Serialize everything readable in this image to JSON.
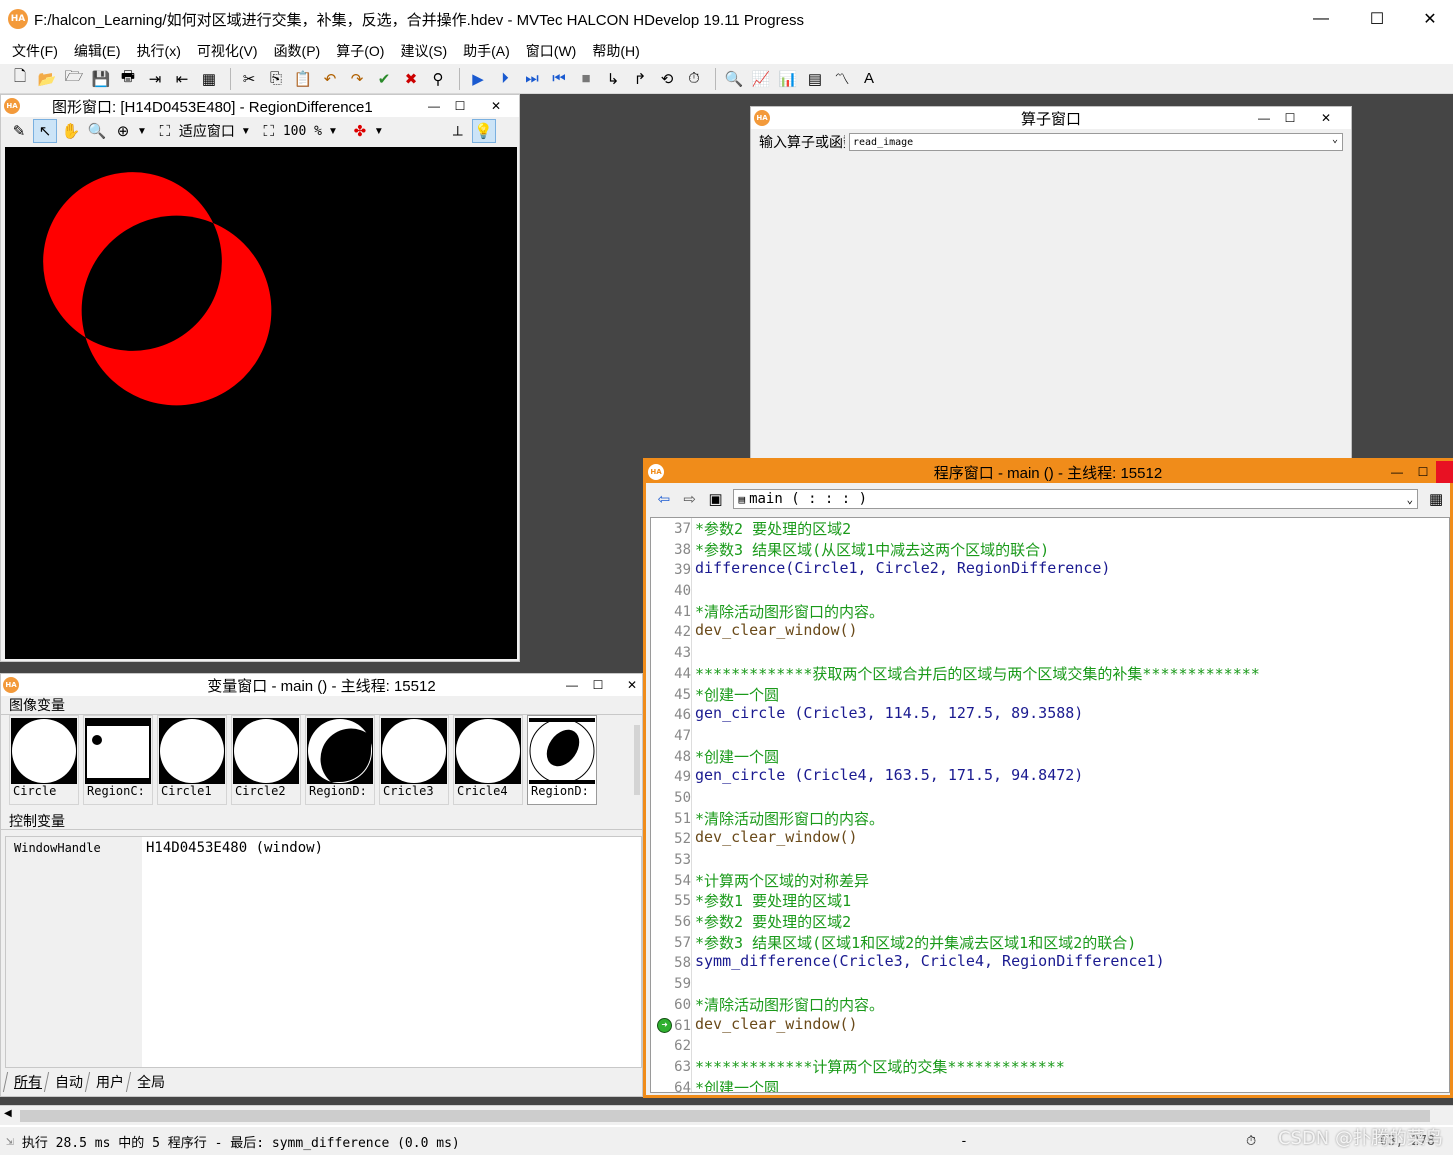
{
  "app": {
    "title": "F:/halcon_Learning/如何对区域进行交集，补集，反选，合并操作.hdev - MVTec HALCON HDevelop 19.11 Progress",
    "icon_text": "HA",
    "minimize": "—",
    "maximize": "☐",
    "close": "✕"
  },
  "menu": [
    "文件(F)",
    "编辑(E)",
    "执行(x)",
    "可视化(V)",
    "函数(P)",
    "算子(O)",
    "建议(S)",
    "助手(A)",
    "窗口(W)",
    "帮助(H)"
  ],
  "graphics_window": {
    "title": "图形窗口: [H14D0453E480] - RegionDifference1",
    "fit_label": "适应窗口",
    "zoom_label": "100 %",
    "region_color": "#ff0000"
  },
  "operator_window": {
    "title": "算子窗口",
    "input_label": "输入算子或函数",
    "input_value": "read_image"
  },
  "variable_window": {
    "title": "变量窗口 - main () - 主线程: 15512",
    "image_vars_label": "图像变量",
    "control_vars_label": "控制变量",
    "icons": [
      {
        "name": "Circle",
        "shape": "circle"
      },
      {
        "name": "RegionC:",
        "shape": "regionc"
      },
      {
        "name": "Circle1",
        "shape": "circle"
      },
      {
        "name": "Circle2",
        "shape": "circle"
      },
      {
        "name": "RegionD:",
        "shape": "regiond"
      },
      {
        "name": "Cricle3",
        "shape": "circle"
      },
      {
        "name": "Cricle4",
        "shape": "circle"
      },
      {
        "name": "RegionD:",
        "shape": "regiond2"
      }
    ],
    "control_name": "WindowHandle",
    "control_value": "H14D0453E480 (window)",
    "tabs": [
      "所有",
      "自动",
      "用户",
      "全局"
    ]
  },
  "program_window": {
    "title": "程序窗口 - main () - 主线程: 15512",
    "procedure": "main ( : : : )",
    "lines": [
      {
        "n": "37",
        "t": "*参数2 要处理的区域2",
        "k": "comment"
      },
      {
        "n": "38",
        "t": "*参数3 结果区域(从区域1中减去这两个区域的联合)",
        "k": "comment"
      },
      {
        "n": "39",
        "t": "difference(Circle1, Circle2, RegionDifference)",
        "k": "op"
      },
      {
        "n": "40",
        "t": "",
        "k": "blank"
      },
      {
        "n": "41",
        "t": "*清除活动图形窗口的内容。",
        "k": "comment"
      },
      {
        "n": "42",
        "t": "dev_clear_window()",
        "k": "ctrl"
      },
      {
        "n": "43",
        "t": "",
        "k": "blank"
      },
      {
        "n": "44",
        "t": "*************获取两个区域合并后的区域与两个区域交集的补集*************",
        "k": "comment"
      },
      {
        "n": "45",
        "t": "*创建一个圆",
        "k": "comment"
      },
      {
        "n": "46",
        "t": "gen_circle (Cricle3, 114.5, 127.5, 89.3588)",
        "k": "op"
      },
      {
        "n": "47",
        "t": "",
        "k": "blank"
      },
      {
        "n": "48",
        "t": "*创建一个圆",
        "k": "comment"
      },
      {
        "n": "49",
        "t": "gen_circle (Cricle4, 163.5, 171.5, 94.8472)",
        "k": "op"
      },
      {
        "n": "50",
        "t": "",
        "k": "blank"
      },
      {
        "n": "51",
        "t": "*清除活动图形窗口的内容。",
        "k": "comment"
      },
      {
        "n": "52",
        "t": "dev_clear_window()",
        "k": "ctrl"
      },
      {
        "n": "53",
        "t": "",
        "k": "blank"
      },
      {
        "n": "54",
        "t": "*计算两个区域的对称差异",
        "k": "comment"
      },
      {
        "n": "55",
        "t": "*参数1 要处理的区域1",
        "k": "comment"
      },
      {
        "n": "56",
        "t": "*参数2 要处理的区域2",
        "k": "comment"
      },
      {
        "n": "57",
        "t": "*参数3 结果区域(区域1和区域2的并集减去区域1和区域2的联合)",
        "k": "comment"
      },
      {
        "n": "58",
        "t": "symm_difference(Cricle3, Cricle4, RegionDifference1)",
        "k": "op"
      },
      {
        "n": "59",
        "t": "",
        "k": "blank"
      },
      {
        "n": "60",
        "t": "*清除活动图形窗口的内容。",
        "k": "comment"
      },
      {
        "n": "61",
        "t": "dev_clear_window()",
        "k": "ctrl",
        "pc": true
      },
      {
        "n": "62",
        "t": "",
        "k": "blank"
      },
      {
        "n": "63",
        "t": "*************计算两个区域的交集*************",
        "k": "comment"
      },
      {
        "n": "64",
        "t": "*创建一个圆",
        "k": "comment"
      }
    ]
  },
  "status": {
    "text": "执行 28.5 ms 中的 5 程序行 - 最后: symm_difference (0.0 ms)",
    "dash": "-",
    "coords": "63, 278",
    "watermark": "CSDN @扑腾的菜鸟"
  }
}
